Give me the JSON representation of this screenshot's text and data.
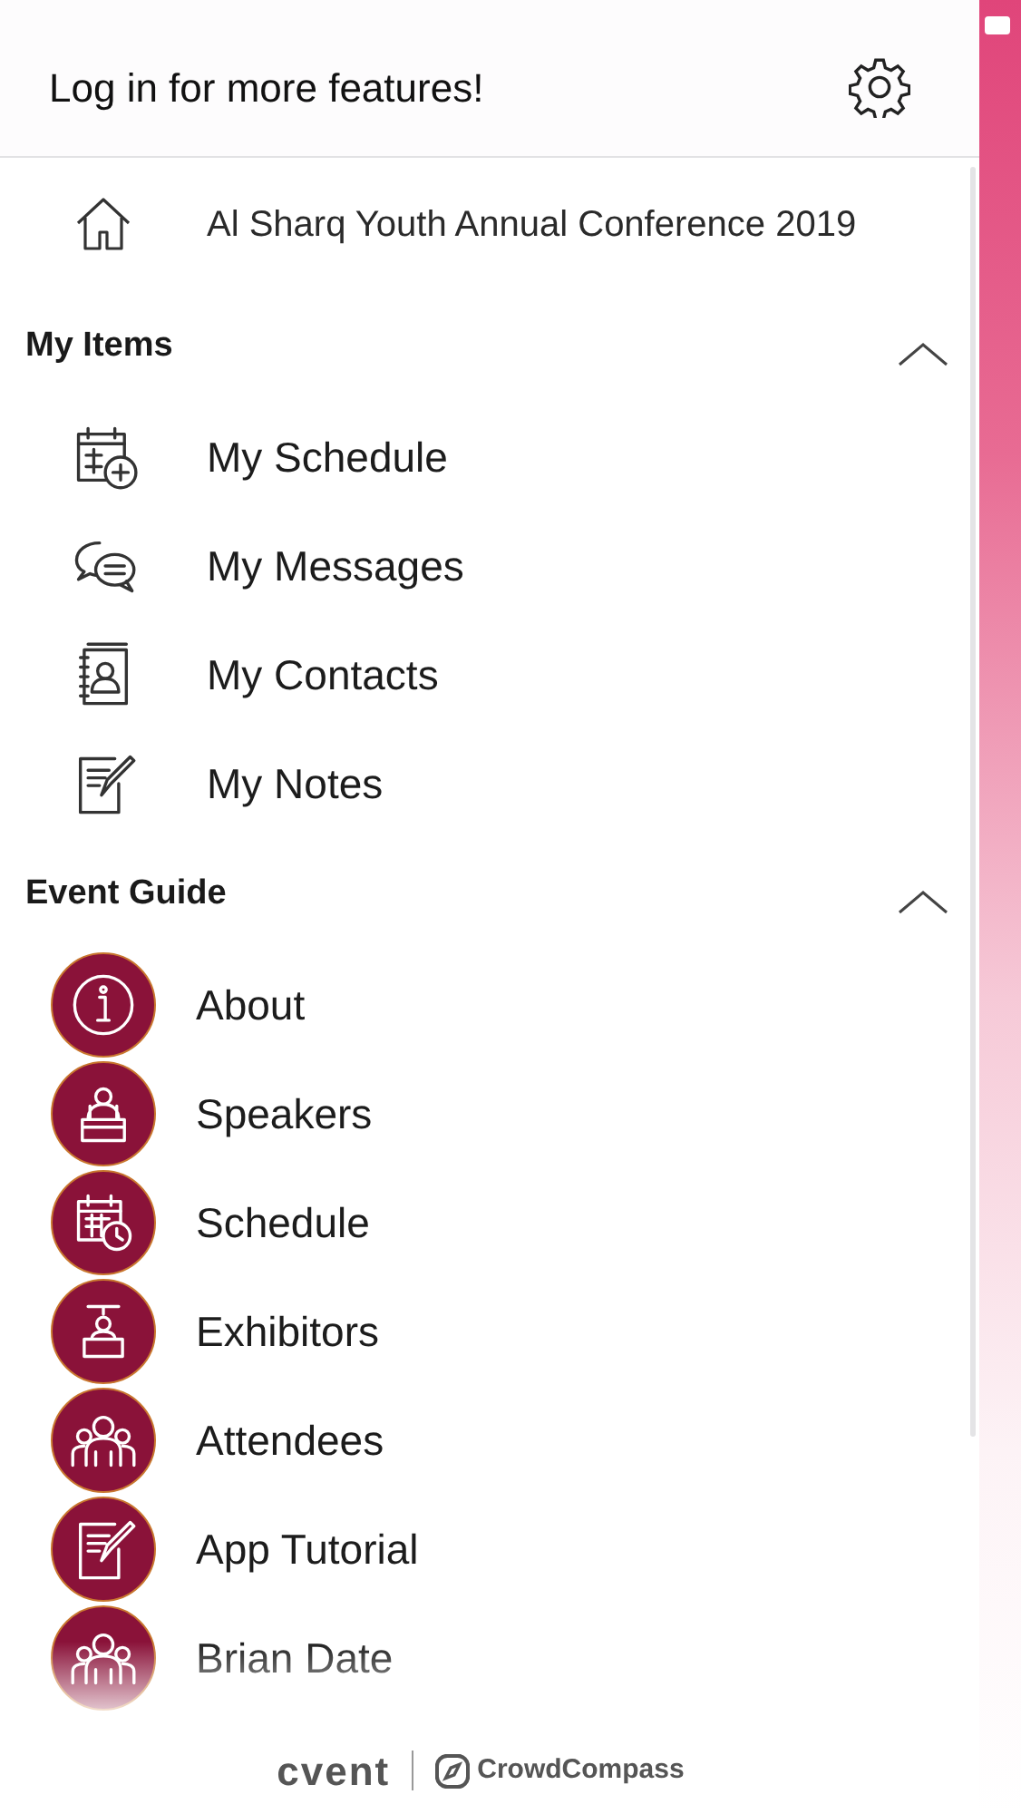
{
  "header": {
    "title": "Log in for more features!"
  },
  "home": {
    "label": "Al Sharq Youth Annual Conference 2019"
  },
  "sections": [
    {
      "title": "My Items",
      "expanded": true,
      "kind": "outline",
      "items": [
        {
          "label": "My Schedule",
          "kind": "calendar-plus"
        },
        {
          "label": "My Messages",
          "kind": "chat"
        },
        {
          "label": "My Contacts",
          "kind": "contact-book"
        },
        {
          "label": "My Notes",
          "kind": "note"
        }
      ]
    },
    {
      "title": "Event Guide",
      "expanded": true,
      "kind": "badge",
      "items": [
        {
          "label": "About",
          "kind": "info"
        },
        {
          "label": "Speakers",
          "kind": "speaker"
        },
        {
          "label": "Schedule",
          "kind": "calendar-clock"
        },
        {
          "label": "Exhibitors",
          "kind": "booth"
        },
        {
          "label": "Attendees",
          "kind": "people"
        },
        {
          "label": "App Tutorial",
          "kind": "note"
        },
        {
          "label": "Brian Date",
          "kind": "people"
        }
      ]
    }
  ],
  "footer": {
    "brands": [
      "cvent",
      "CrowdCompass"
    ]
  }
}
